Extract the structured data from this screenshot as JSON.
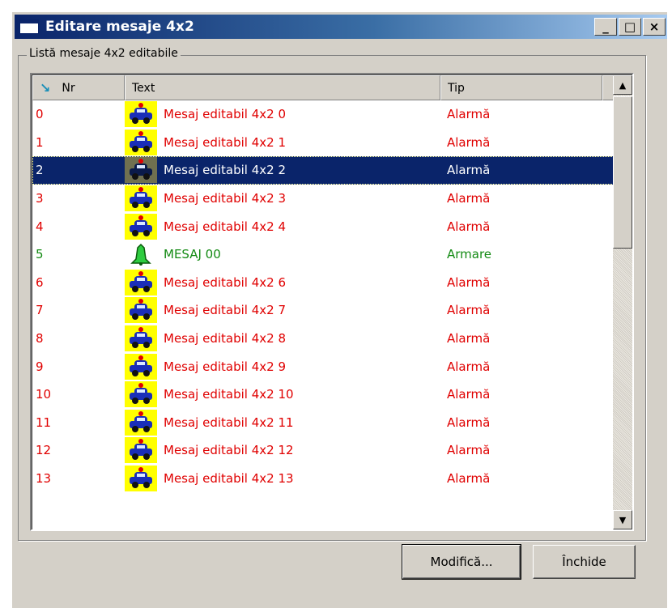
{
  "window": {
    "title": "Editare mesaje 4x2"
  },
  "titlebar_buttons": {
    "minimize": "_",
    "maximize": "□",
    "close": "×"
  },
  "group": {
    "label": "Listă mesaje 4x2 editabile"
  },
  "list": {
    "columns": {
      "nr": "Nr",
      "text": "Text",
      "tip": "Tip"
    },
    "rows": [
      {
        "nr": "0",
        "text": "Mesaj editabil 4x2 0",
        "tip": "Alarmă",
        "icon": "police-car-icon",
        "color": "#e00000"
      },
      {
        "nr": "1",
        "text": "Mesaj editabil 4x2 1",
        "tip": "Alarmă",
        "icon": "police-car-icon",
        "color": "#e00000"
      },
      {
        "nr": "2",
        "text": "Mesaj editabil 4x2 2",
        "tip": "Alarmă",
        "icon": "police-car-icon",
        "color": "#ffffff",
        "selected": true
      },
      {
        "nr": "3",
        "text": "Mesaj editabil 4x2 3",
        "tip": "Alarmă",
        "icon": "police-car-icon",
        "color": "#e00000"
      },
      {
        "nr": "4",
        "text": "Mesaj editabil 4x2 4",
        "tip": "Alarmă",
        "icon": "police-car-icon",
        "color": "#e00000"
      },
      {
        "nr": "5",
        "text": "MESAJ 00",
        "tip": "Armare",
        "icon": "bell-icon",
        "color": "#138a13"
      },
      {
        "nr": "6",
        "text": "Mesaj editabil 4x2 6",
        "tip": "Alarmă",
        "icon": "police-car-icon",
        "color": "#e00000"
      },
      {
        "nr": "7",
        "text": "Mesaj editabil 4x2 7",
        "tip": "Alarmă",
        "icon": "police-car-icon",
        "color": "#e00000"
      },
      {
        "nr": "8",
        "text": "Mesaj editabil 4x2 8",
        "tip": "Alarmă",
        "icon": "police-car-icon",
        "color": "#e00000"
      },
      {
        "nr": "9",
        "text": "Mesaj editabil 4x2 9",
        "tip": "Alarmă",
        "icon": "police-car-icon",
        "color": "#e00000"
      },
      {
        "nr": "10",
        "text": "Mesaj editabil 4x2 10",
        "tip": "Alarmă",
        "icon": "police-car-icon",
        "color": "#e00000"
      },
      {
        "nr": "11",
        "text": "Mesaj editabil 4x2 11",
        "tip": "Alarmă",
        "icon": "police-car-icon",
        "color": "#e00000"
      },
      {
        "nr": "12",
        "text": "Mesaj editabil 4x2 12",
        "tip": "Alarmă",
        "icon": "police-car-icon",
        "color": "#e00000"
      },
      {
        "nr": "13",
        "text": "Mesaj editabil 4x2 13",
        "tip": "Alarmă",
        "icon": "police-car-icon",
        "color": "#e00000"
      }
    ]
  },
  "buttons": {
    "modify": "Modifică...",
    "close": "Închide"
  }
}
